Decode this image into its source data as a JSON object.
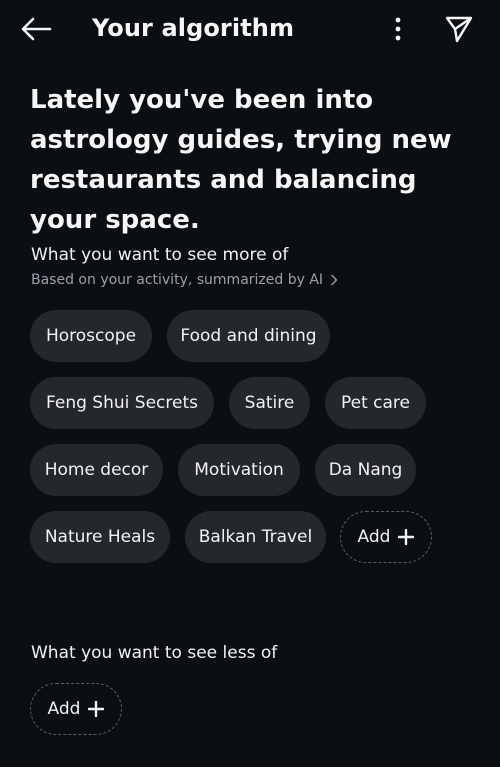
{
  "header": {
    "title": "Your algorithm",
    "back_icon": "arrow-left-icon",
    "more_icon": "more-vertical-icon",
    "share_icon": "send-icon"
  },
  "summary": "Lately you've been into astrology guides, trying new restaurants and balancing your space.",
  "more_of": {
    "title": "What you want to see more of",
    "subtitle": "Based on your activity, summarized by AI",
    "subtitle_icon": "chevron-right-icon",
    "topics": [
      "Horoscope",
      "Food and dining",
      "Feng Shui Secrets",
      "Satire",
      "Pet care",
      "Home decor",
      "Motivation",
      "Da Nang",
      "Nature Heals",
      "Balkan Travel"
    ],
    "add_label": "Add",
    "add_icon": "plus-icon"
  },
  "less_of": {
    "title": "What you want to see less of",
    "add_label": "Add",
    "add_icon": "plus-icon"
  },
  "colors": {
    "background": "#0b0e12",
    "chip": "#24272c",
    "text": "#f5f5f5",
    "muted": "#9aa0a8"
  }
}
